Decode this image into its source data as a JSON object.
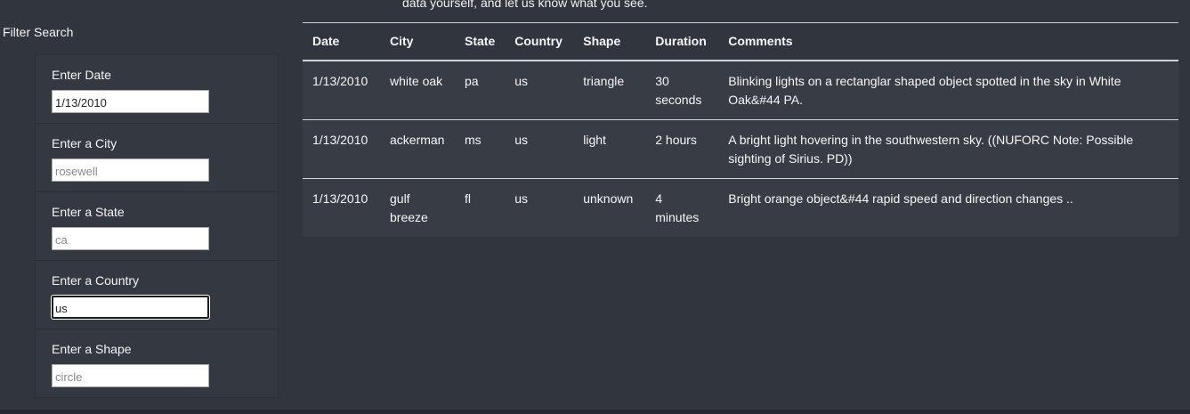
{
  "intro": {
    "text": "data yourself, and let us know what you see."
  },
  "filters": {
    "title": "Filter Search",
    "items": [
      {
        "label": "Enter Date",
        "value": "1/13/2010",
        "placeholder": ""
      },
      {
        "label": "Enter a City",
        "value": "",
        "placeholder": "rosewell"
      },
      {
        "label": "Enter a State",
        "value": "",
        "placeholder": "ca"
      },
      {
        "label": "Enter a Country",
        "value": "us",
        "placeholder": ""
      },
      {
        "label": "Enter a Shape",
        "value": "",
        "placeholder": "circle"
      }
    ]
  },
  "table": {
    "headers": [
      "Date",
      "City",
      "State",
      "Country",
      "Shape",
      "Duration",
      "Comments"
    ],
    "rows": [
      [
        "1/13/2010",
        "white oak",
        "pa",
        "us",
        "triangle",
        "30 seconds",
        "Blinking lights on a rectanglar shaped object spotted in the sky in White Oak&#44 PA."
      ],
      [
        "1/13/2010",
        "ackerman",
        "ms",
        "us",
        "light",
        "2 hours",
        "A bright light hovering in the southwestern sky. ((NUFORC Note: Possible sighting of Sirius. PD))"
      ],
      [
        "1/13/2010",
        "gulf breeze",
        "fl",
        "us",
        "unknown",
        "4 minutes",
        "Bright orange object&#44 rapid speed and direction changes .."
      ]
    ]
  }
}
